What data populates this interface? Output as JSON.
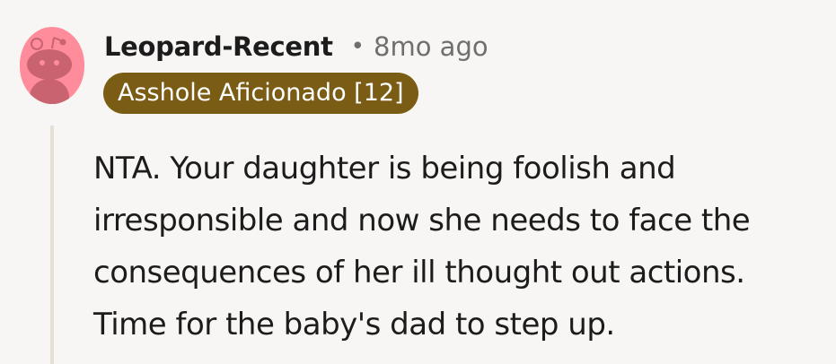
{
  "comment": {
    "avatar_icon": "snoo-avatar-icon",
    "username": "Leopard-Recent",
    "separator": "•",
    "timestamp": "8mo ago",
    "flair": "Asshole Aficionado [12]",
    "body_lines": [
      "NTA. Your daughter is being foolish and",
      "irresponsible and now she needs to face the",
      "consequences of her ill thought out actions.",
      "Time for the baby's dad to step up."
    ]
  },
  "colors": {
    "background": "#f8f6f4",
    "avatar_bg": "#ff8c9a",
    "flair_bg": "#7a5c14",
    "thread_line": "#e6dfd6"
  }
}
